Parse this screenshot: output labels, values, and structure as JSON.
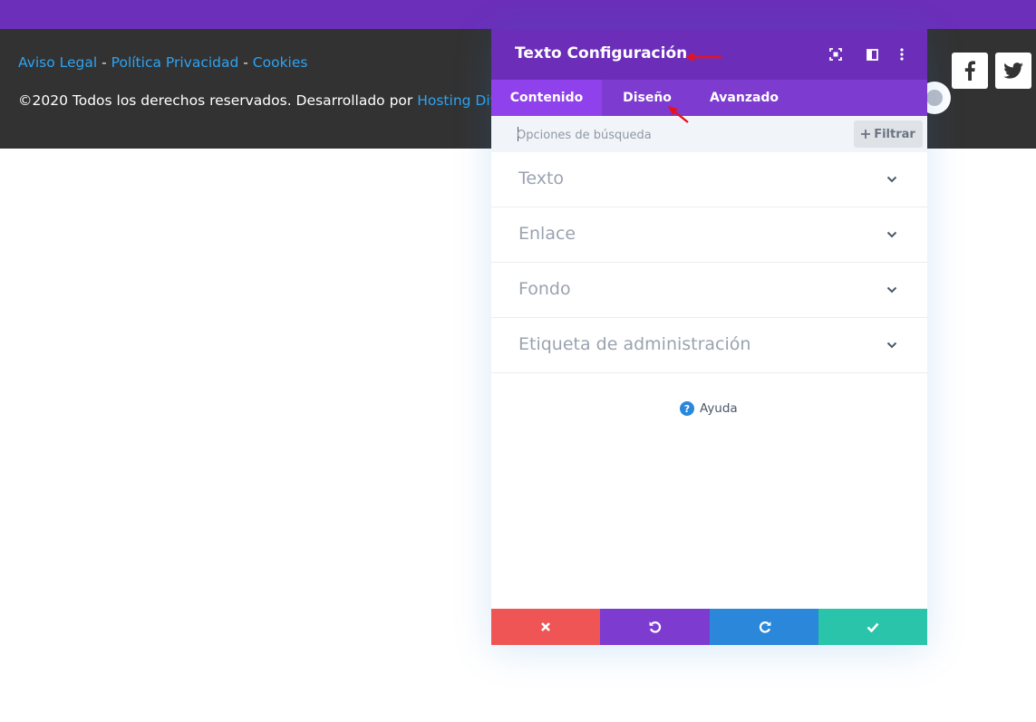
{
  "footer": {
    "links": [
      "Aviso Legal",
      "Política Privacidad",
      "Cookies"
    ],
    "separator": "-",
    "copyright": "©2020 Todos los derechos reservados. Desarrollado por",
    "copyright_link": "Hosting Divi"
  },
  "social": {
    "facebook_icon": "facebook-icon",
    "twitter_icon": "twitter-icon"
  },
  "modal": {
    "title": "Texto Configuración",
    "header_icons": [
      "fullscreen-icon",
      "split-view-icon",
      "more-options-icon"
    ],
    "tabs": [
      {
        "label": "Contenido",
        "active": true
      },
      {
        "label": "Diseño",
        "active": false
      },
      {
        "label": "Avanzado",
        "active": false
      }
    ],
    "search": {
      "placeholder": "Opciones de búsqueda",
      "value": ""
    },
    "filter_label": "Filtrar",
    "sections": [
      "Texto",
      "Enlace",
      "Fondo",
      "Etiqueta de administración"
    ],
    "help_label": "Ayuda",
    "actions": [
      "cancel",
      "undo",
      "redo",
      "save"
    ]
  },
  "colors": {
    "accent_purple": "#6c2eb9",
    "tab_active": "#8f42ec",
    "cancel": "#ef5555",
    "undo": "#7e3bd0",
    "redo": "#2b87da",
    "save": "#29c4a9",
    "annotation_arrow": "#e8121d"
  }
}
